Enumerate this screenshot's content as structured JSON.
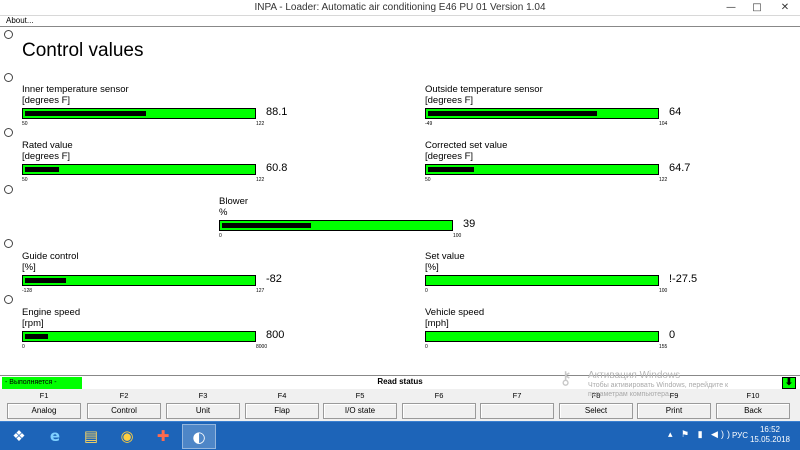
{
  "window": {
    "title": "INPA - Loader:  Automatic air conditioning E46 PU 01 Version 1.04",
    "minimize_glyph": "—",
    "maximize_glyph": "□",
    "close_glyph": "✕"
  },
  "menu": {
    "about": "About..."
  },
  "page": {
    "title": "Control values"
  },
  "gauges": {
    "inner_temp": {
      "name": "Inner temperature sensor",
      "unit": "[degrees F]",
      "min": "50",
      "max": "122",
      "value": "88.1",
      "level": 0.53
    },
    "outside_temp": {
      "name": "Outside temperature sensor",
      "unit": "[degrees F]",
      "min": "-49",
      "max": "104",
      "value": "64",
      "level": 0.74
    },
    "rated_value": {
      "name": "Rated value",
      "unit": "[degrees F]",
      "min": "50",
      "max": "122",
      "value": "60.8",
      "level": 0.15
    },
    "corrected_set_value": {
      "name": "Corrected set value",
      "unit": "[degrees F]",
      "min": "50",
      "max": "122",
      "value": "64.7",
      "level": 0.2
    },
    "blower": {
      "name": "Blower",
      "unit": "%",
      "min": "0",
      "max": "100",
      "value": "39",
      "level": 0.39
    },
    "guide_control": {
      "name": "Guide control",
      "unit": "[%]",
      "min": "-128",
      "max": "127",
      "value": "-82",
      "level": 0.18
    },
    "set_value": {
      "name": "Set value",
      "unit": "[%]",
      "min": "0",
      "max": "100",
      "value": "!-27.5",
      "level": 0
    },
    "engine_speed": {
      "name": "Engine speed",
      "unit": "[rpm]",
      "min": "0",
      "max": "8000",
      "value": "800",
      "level": 0.1
    },
    "vehicle_speed": {
      "name": "Vehicle speed",
      "unit": "[mph]",
      "min": "0",
      "max": "155",
      "value": "0",
      "level": 0
    }
  },
  "status": {
    "running": "- Выполняется -",
    "read_status": "Read status",
    "arrow_glyph": "⬇"
  },
  "fkeys": [
    {
      "key": "F1",
      "label": "Analog"
    },
    {
      "key": "F2",
      "label": "Control"
    },
    {
      "key": "F3",
      "label": "Unit"
    },
    {
      "key": "F4",
      "label": "Flap"
    },
    {
      "key": "F5",
      "label": "I/O state"
    },
    {
      "key": "F6",
      "label": ""
    },
    {
      "key": "F7",
      "label": ""
    },
    {
      "key": "F8",
      "label": "Select"
    },
    {
      "key": "F9",
      "label": "Print"
    },
    {
      "key": "F10",
      "label": "Back"
    }
  ],
  "watermark": {
    "title": "Активация Windows",
    "line1": "Чтобы активировать Windows, перейдите к",
    "line2": "параметрам компьютера."
  },
  "taskbar": {
    "start_glyph": "❖",
    "ie_glyph": "e",
    "explorer_glyph": "▤",
    "chrome_glyph": "◉",
    "app_glyph": "✚",
    "bmw_glyph": "◐",
    "tray_glyphs": "▴ ⚑ ▮ ◀))",
    "language": "РУС",
    "time": "16:52",
    "date": "15.05.2018"
  },
  "colors": {
    "gauge_green": "#00ff00",
    "gauge_fill": "#000000",
    "taskbar": "#1d64b8"
  }
}
